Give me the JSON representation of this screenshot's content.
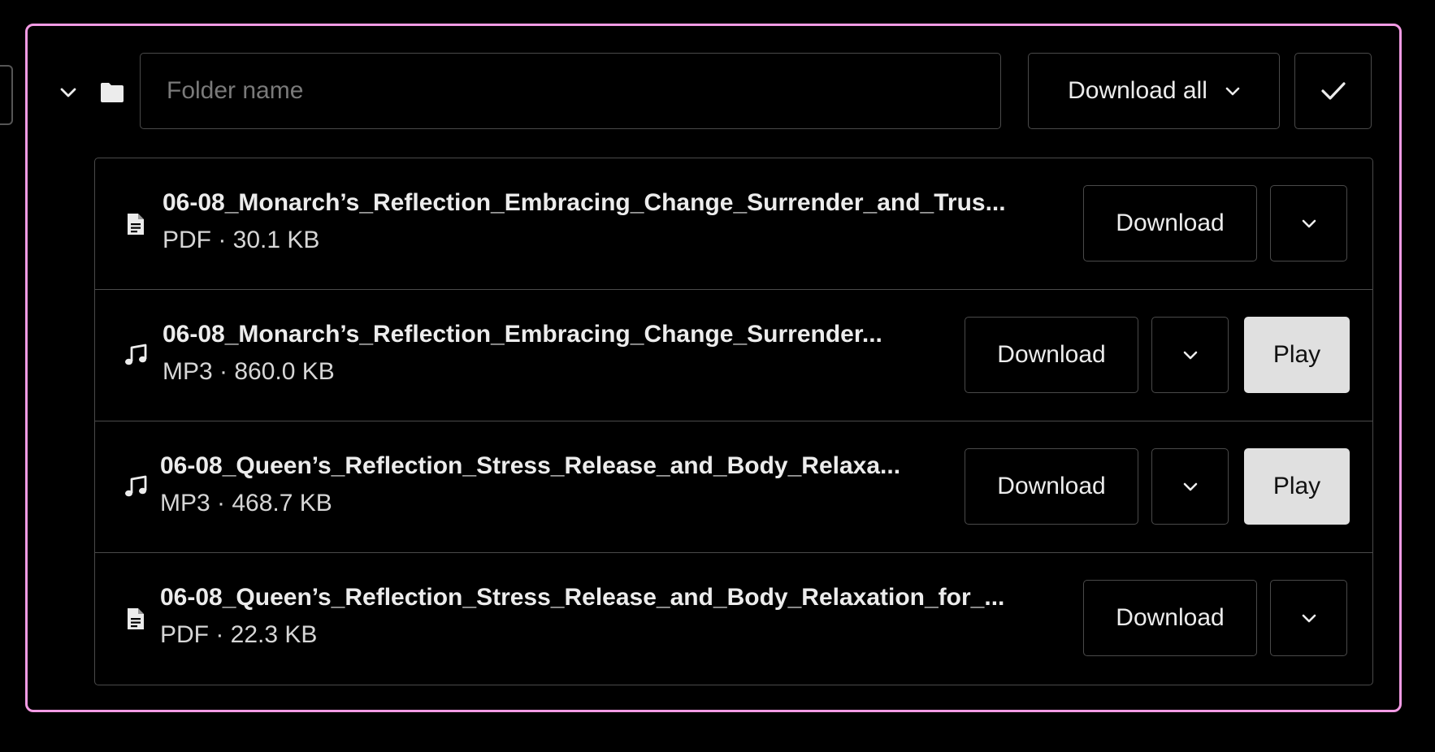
{
  "folder": {
    "name_value": "",
    "name_placeholder": "Folder name",
    "download_all_label": "Download all"
  },
  "files": [
    {
      "icon": "document-icon",
      "name": "06-08_Monarch’s_Reflection_Embracing_Change_Surrender_and_Trus...",
      "meta": "PDF · 30.1 KB",
      "download_label": "Download",
      "play_label": null
    },
    {
      "icon": "music-note-icon",
      "name": "06-08_Monarch’s_Reflection_Embracing_Change_Surrender...",
      "meta": "MP3 · 860.0 KB",
      "download_label": "Download",
      "play_label": "Play"
    },
    {
      "icon": "music-note-icon",
      "name": "06-08_Queen’s_Reflection_Stress_Release_and_Body_Relaxa...",
      "meta": "MP3 · 468.7 KB",
      "download_label": "Download",
      "play_label": "Play"
    },
    {
      "icon": "document-icon",
      "name": "06-08_Queen’s_Reflection_Stress_Release_and_Body_Relaxation_for_...",
      "meta": "PDF · 22.3 KB",
      "download_label": "Download",
      "play_label": null
    }
  ],
  "colors": {
    "panel_border": "#f39be4",
    "background": "#000000",
    "border": "#4a4a4a",
    "text": "#ececec",
    "play_button_bg": "#e0e0e0"
  }
}
